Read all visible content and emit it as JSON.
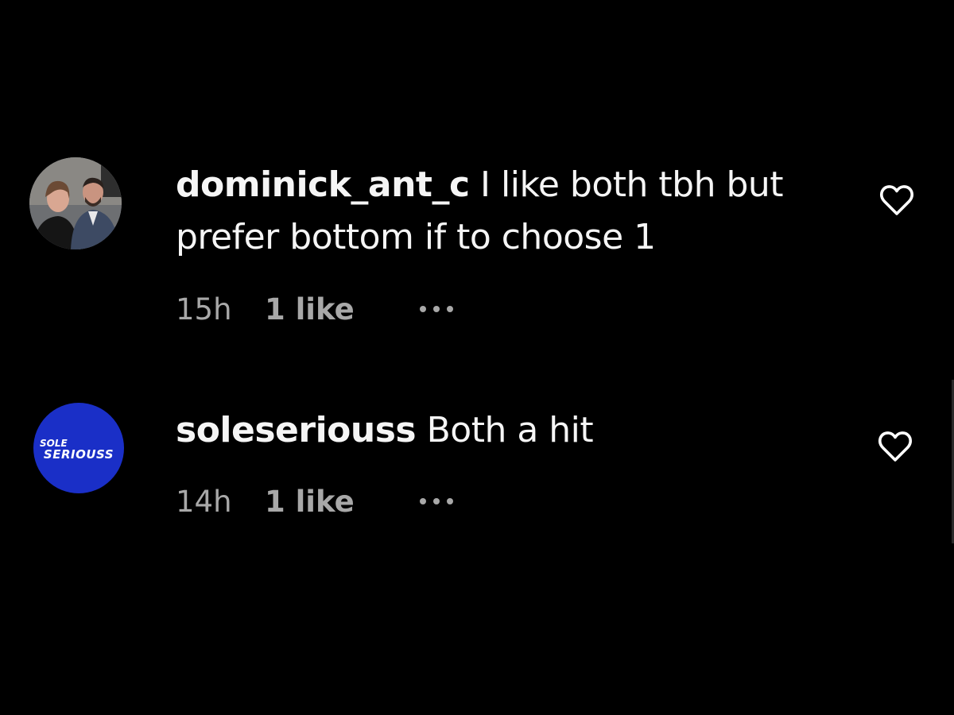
{
  "comments": [
    {
      "username": "dominick_ant_c",
      "text": "I like both tbh but prefer bottom if to choose 1",
      "time": "15h",
      "likes": "1 like"
    },
    {
      "username": "soleseriouss",
      "text": "Both a hit",
      "time": "14h",
      "likes": "1 like",
      "avatar_logo_line1": "SOLE",
      "avatar_logo_line2": "SERIOUSS"
    }
  ],
  "colors": {
    "background": "#000000",
    "text": "#f5f5f5",
    "muted": "#a8a8a8",
    "sole_avatar_blue": "#1a2fc7"
  }
}
